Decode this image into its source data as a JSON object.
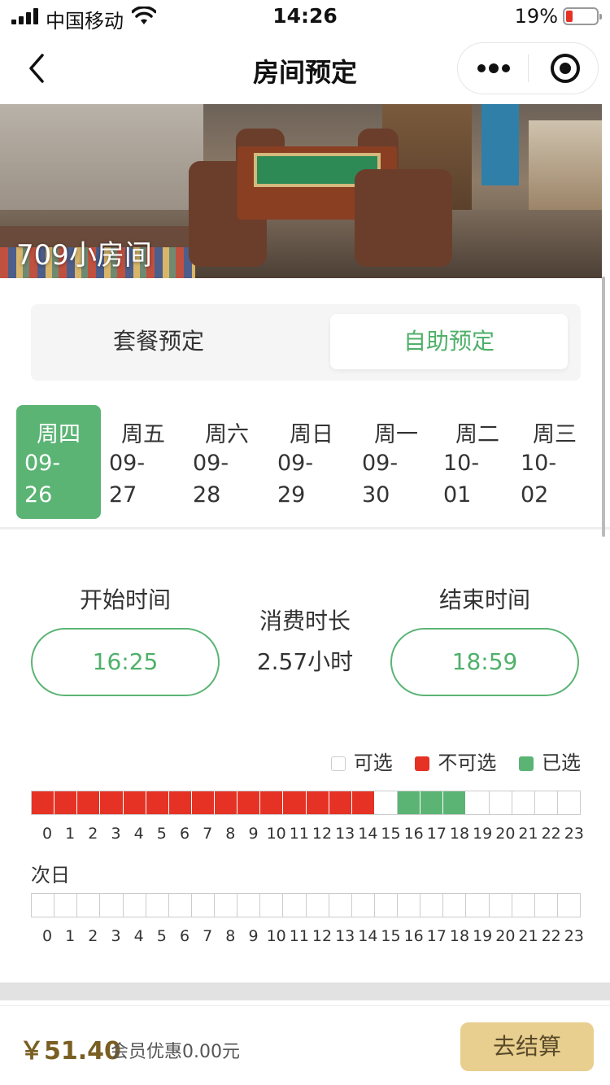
{
  "status_bar": {
    "carrier": "中国移动",
    "time": "14:26",
    "battery_percent": "19%",
    "battery_level": 0.19
  },
  "nav": {
    "title": "房间预定"
  },
  "hero": {
    "room_name": "709小房间"
  },
  "tabs": [
    {
      "label": "套餐预定",
      "selected": false
    },
    {
      "label": "自助预定",
      "selected": true
    }
  ],
  "dates": [
    {
      "weekday": "周四",
      "date": "09-\n26",
      "selected": true
    },
    {
      "weekday": "周五",
      "date": "09-\n27",
      "selected": false
    },
    {
      "weekday": "周六",
      "date": "09-\n28",
      "selected": false
    },
    {
      "weekday": "周日",
      "date": "09-\n29",
      "selected": false
    },
    {
      "weekday": "周一",
      "date": "09-\n30",
      "selected": false
    },
    {
      "weekday": "周二",
      "date": "10-\n01",
      "selected": false
    },
    {
      "weekday": "周三",
      "date": "10-\n02",
      "selected": false
    }
  ],
  "time_select": {
    "start_label": "开始时间",
    "start_value": "16:25",
    "duration_label": "消费时长",
    "duration_value": "2.57小时",
    "end_label": "结束时间",
    "end_value": "18:59"
  },
  "legend": {
    "available": "可选",
    "unavailable": "不可选",
    "selected": "已选"
  },
  "colors": {
    "accent_green": "#5bb474",
    "unavailable_red": "#e53224",
    "checkout_gold": "#e8cf8f"
  },
  "today_hours": {
    "unavailable": [
      0,
      1,
      2,
      3,
      4,
      5,
      6,
      7,
      8,
      9,
      10,
      11,
      12,
      13,
      14
    ],
    "selected": [
      16,
      17,
      18
    ]
  },
  "next_day": {
    "label": "次日",
    "unavailable": [],
    "selected": []
  },
  "hour_labels": [
    "0",
    "1",
    "2",
    "3",
    "4",
    "5",
    "6",
    "7",
    "8",
    "9",
    "10",
    "11",
    "12",
    "13",
    "14",
    "15",
    "16",
    "17",
    "18",
    "19",
    "20",
    "21",
    "22",
    "23"
  ],
  "footer": {
    "price": "￥51.40",
    "discount": "会员优惠0.00元",
    "checkout": "去结算"
  }
}
